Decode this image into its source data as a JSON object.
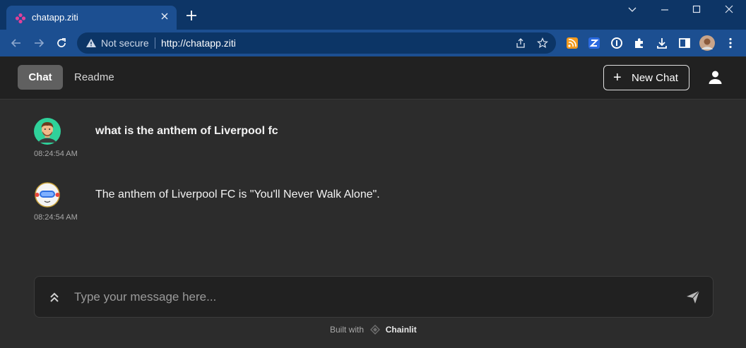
{
  "browser": {
    "tab_title": "chatapp.ziti",
    "security_label": "Not secure",
    "url": "http://chatapp.ziti",
    "colors": {
      "titlebar": "#0d3566",
      "toolbar": "#1c4f91"
    }
  },
  "header": {
    "nav": [
      {
        "label": "Chat",
        "active": true
      },
      {
        "label": "Readme",
        "active": false
      }
    ],
    "new_chat_label": "New Chat"
  },
  "messages": [
    {
      "author": "user",
      "text": "what is the anthem of Liverpool fc",
      "time": "08:24:54 AM"
    },
    {
      "author": "assistant",
      "text": "The anthem of Liverpool FC is \"You'll Never Walk Alone\".",
      "time": "08:24:54 AM"
    }
  ],
  "composer": {
    "placeholder": "Type your message here...",
    "value": ""
  },
  "footer": {
    "built_with": "Built with",
    "brand": "Chainlit"
  }
}
